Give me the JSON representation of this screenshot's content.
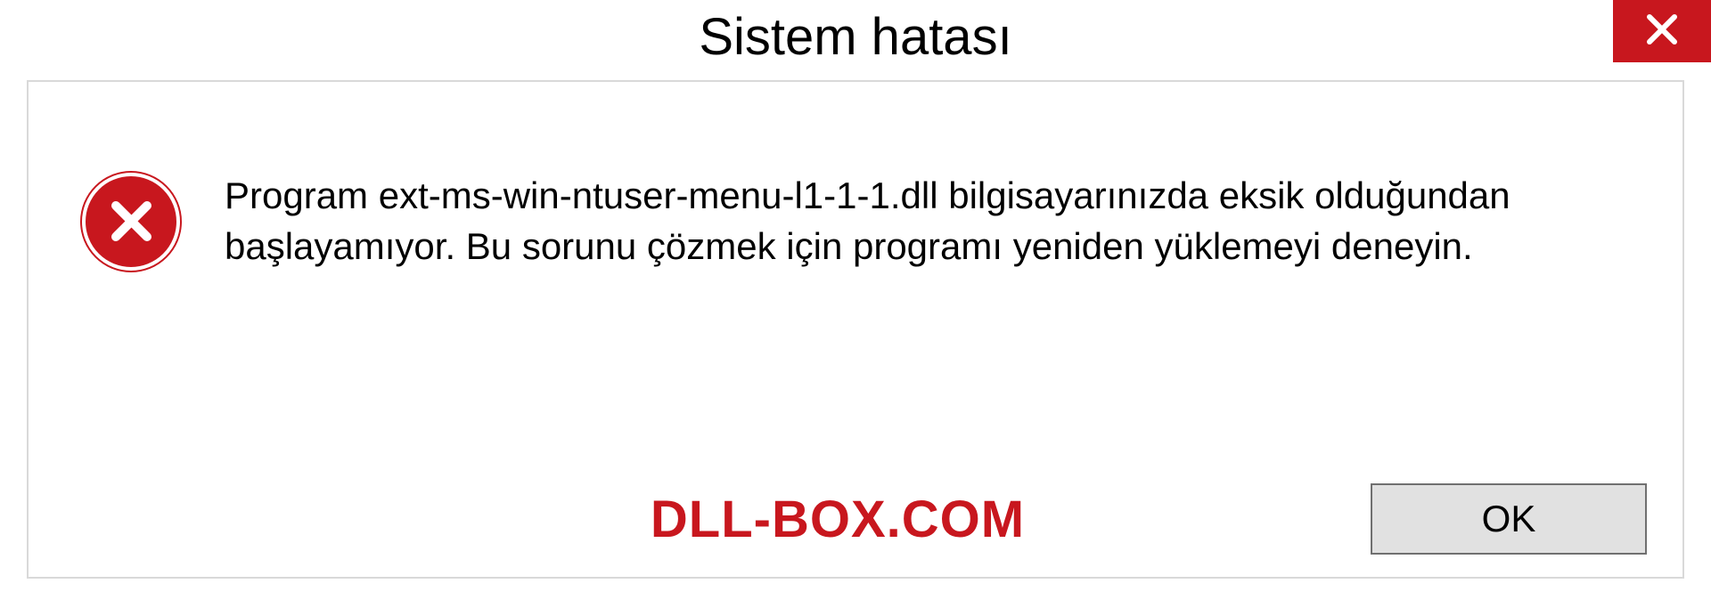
{
  "dialog": {
    "title": "Sistem hatası",
    "message": "Program ext-ms-win-ntuser-menu-l1-1-1.dll bilgisayarınızda eksik olduğundan başlayamıyor. Bu sorunu çözmek için programı yeniden yüklemeyi deneyin.",
    "ok_label": "OK"
  },
  "watermark": "DLL-BOX.COM",
  "colors": {
    "error_red": "#c8171e",
    "button_bg": "#e1e1e1",
    "border_gray": "#d9d9d9"
  }
}
